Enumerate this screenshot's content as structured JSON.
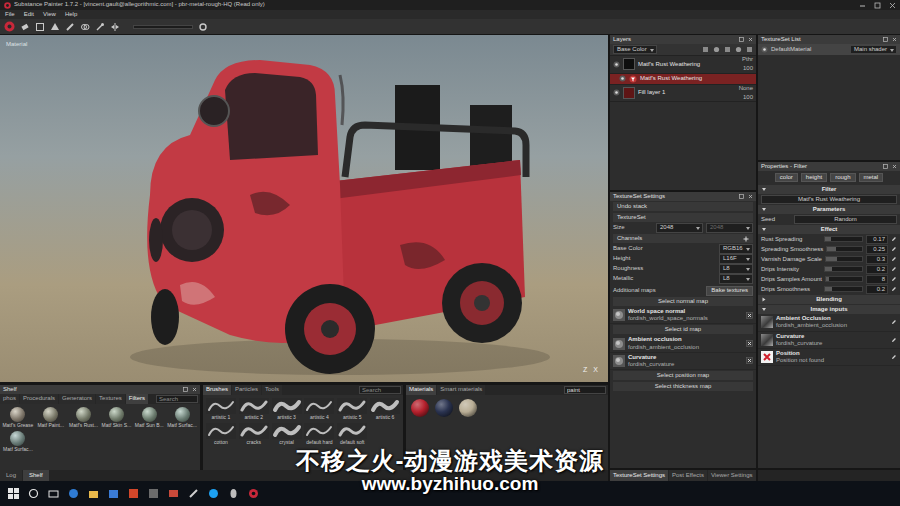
{
  "window": {
    "title": "Substance Painter 1.7.2 - [vincent.gault@allegorithmic.com] - pbr-metal-rough-HQ (Read only)"
  },
  "menu": [
    "File",
    "Edit",
    "View",
    "Help"
  ],
  "viewport": {
    "label": "Material",
    "axes": [
      "Z",
      "X"
    ]
  },
  "layers": {
    "title": "Layers",
    "channel": "Base Color",
    "items": [
      {
        "name": "Matf's Rust Weathering",
        "blend": "Pthr",
        "opacity": "100",
        "kind": "folder",
        "selected": false,
        "visible": true
      },
      {
        "name": "Matf's Rust Weathering",
        "kind": "filter",
        "selected": true,
        "visible": true
      },
      {
        "name": "Fill layer 1",
        "blend": "None",
        "opacity": "100",
        "kind": "fill",
        "selected": false,
        "visible": true
      }
    ]
  },
  "textureset_list": {
    "title": "TextureSet List",
    "items": [
      {
        "name": "DefaultMaterial",
        "shader": "Main shader",
        "selected": true
      }
    ]
  },
  "properties": {
    "title": "Properties - Filter",
    "channels": [
      "color",
      "height",
      "rough",
      "metal"
    ],
    "sections": [
      {
        "title": "Filter",
        "expanded": true,
        "kind": "value",
        "value": "Matf's Rust Weathering"
      },
      {
        "title": "Parameters",
        "expanded": true,
        "kind": "fields",
        "rows": [
          {
            "label": "Seed",
            "value": "Random"
          }
        ]
      },
      {
        "title": "Effect",
        "expanded": true,
        "kind": "sliders",
        "rows": [
          {
            "label": "Rust Spreading",
            "value": "0.17",
            "level": 0.17
          },
          {
            "label": "Spreading Smoothness",
            "value": "0.25",
            "level": 0.25
          },
          {
            "label": "Varnish Damage Scale",
            "value": "0.3",
            "level": 0.3
          },
          {
            "label": "Drips Intensity",
            "value": "0.2",
            "level": 0.2
          },
          {
            "label": "Drips Samples Amount",
            "value": "8",
            "level": 0.08
          },
          {
            "label": "Drips Smoothness",
            "value": "0.2",
            "level": 0.2
          }
        ]
      },
      {
        "title": "Blending",
        "expanded": false,
        "kind": "none"
      },
      {
        "title": "Image inputs",
        "expanded": true,
        "kind": "images",
        "rows": [
          {
            "label": "Ambient Occlusion",
            "value": "fordish_ambient_occlusion",
            "found": true
          },
          {
            "label": "Curvature",
            "value": "fordish_curvature",
            "found": true
          },
          {
            "label": "Position",
            "value": "Position not found",
            "found": false
          }
        ]
      }
    ]
  },
  "textureset_settings": {
    "title": "TextureSet Settings",
    "undo": "Undo stack",
    "section": "TextureSet",
    "size": {
      "label": "Size",
      "values": [
        {
          "value": "2048",
          "disabled": false
        },
        {
          "value": "2048",
          "disabled": true
        }
      ]
    },
    "channels_label": "Channels",
    "channels": [
      {
        "name": "Base Color",
        "format": "RGB16"
      },
      {
        "name": "Height",
        "format": "L16F"
      },
      {
        "name": "Roughness",
        "format": "L8"
      },
      {
        "name": "Metallic",
        "format": "L8"
      }
    ],
    "additional": {
      "label": "Additional maps",
      "button": "Bake textures"
    },
    "maps": [
      {
        "kind": "button",
        "label": "Select normal map"
      },
      {
        "kind": "map",
        "label": "World space normal",
        "file": "fordish_world_space_normals"
      },
      {
        "kind": "button",
        "label": "Select id map"
      },
      {
        "kind": "map",
        "label": "Ambient occlusion",
        "file": "fordish_ambient_occlusion"
      },
      {
        "kind": "map",
        "label": "Curvature",
        "file": "fordish_curvature"
      },
      {
        "kind": "button",
        "label": "Select position map"
      },
      {
        "kind": "button",
        "label": "Select thickness map"
      }
    ]
  },
  "shelf": {
    "title": "Shelf",
    "tabs": [
      {
        "label": "phos",
        "selected": false
      },
      {
        "label": "Procedurals",
        "selected": false
      },
      {
        "label": "Generators",
        "selected": false
      },
      {
        "label": "Textures",
        "selected": false
      },
      {
        "label": "Filters",
        "selected": true
      }
    ],
    "search": {
      "placeholder": "Search"
    },
    "items": [
      "Matf's Grease",
      "Matf Paint...",
      "Matf's Rust...",
      "Matf Skin S...",
      "Matf Sun B...",
      "Matf Surfac...",
      "Matf Surfac..."
    ]
  },
  "brushes": {
    "tabs": [
      {
        "label": "Brushes",
        "selected": true
      },
      {
        "label": "Particles",
        "selected": false
      },
      {
        "label": "Tools",
        "selected": false
      }
    ],
    "search": {
      "placeholder": "Search"
    },
    "items": [
      "artistic 1",
      "artistic 2",
      "artistic 3",
      "artistic 4",
      "artistic 5",
      "artistic 6",
      "cotton",
      "cracks",
      "crystal",
      "default hard",
      "default soft"
    ]
  },
  "materials": {
    "tabs": [
      {
        "label": "Materials",
        "selected": true
      },
      {
        "label": "Smart materials",
        "selected": false
      }
    ],
    "search": {
      "value": "paint"
    },
    "items": [
      {
        "color": "#b5202c"
      },
      {
        "color": "#2a3350"
      },
      {
        "color": "#b8ad95"
      }
    ]
  },
  "shelf_tabs": [
    {
      "label": "Log",
      "selected": false
    },
    {
      "label": "Shelf",
      "selected": true
    }
  ],
  "settings_tabs": [
    {
      "label": "TextureSet Settings",
      "selected": true
    },
    {
      "label": "Post Effects",
      "selected": false
    },
    {
      "label": "Viewer Settings",
      "selected": false
    }
  ],
  "watermark": {
    "text": "不移之火-动漫游戏美术资源",
    "url": "www.byzhihuo.com"
  }
}
